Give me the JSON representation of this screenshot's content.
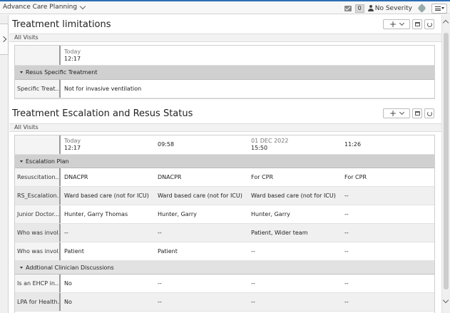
{
  "topbar": {
    "app_title": "Advance Care Planning",
    "count": "0",
    "severity": "No Severity"
  },
  "treatment_limitations": {
    "title": "Treatment limitations",
    "visits_label": "All Visits",
    "columns": [
      {
        "day": "Today",
        "time": "12:17"
      }
    ],
    "group": "Resus Specific Treatment",
    "rows": [
      {
        "label": "Specific Treat...",
        "values": [
          "Not for invasive ventilation"
        ]
      }
    ]
  },
  "escalation": {
    "title": "Treatment Escalation and Resus Status",
    "visits_label": "All Visits",
    "columns": [
      {
        "day": "Today",
        "time": "12:17"
      },
      {
        "day": "",
        "time": "09:58"
      },
      {
        "day": "01 DEC 2022",
        "time": "15:50"
      },
      {
        "day": "",
        "time": "11:26"
      }
    ],
    "group1": "Escalation Plan",
    "rows1": [
      {
        "label": "Resuscitation...",
        "values": [
          "DNACPR",
          "DNACPR",
          "For CPR",
          "For CPR"
        ]
      },
      {
        "label": "RS_Escalation...",
        "values": [
          "Ward based care (not for ICU)",
          "Ward based care (not for ICU)",
          "Ward based care (not for ICU)",
          "--"
        ]
      },
      {
        "label": "Junior Doctor...",
        "values": [
          "Hunter, Garry Thomas",
          "Hunter, Garry",
          "Hunter, Garry",
          "--"
        ]
      },
      {
        "label": "Who was invol...",
        "values": [
          "--",
          "--",
          "Patient, Wider team",
          "--"
        ]
      },
      {
        "label": "Who was invol...",
        "values": [
          "Patient",
          "Patient",
          "--",
          "--"
        ]
      }
    ],
    "group2": "Addtional Clinician Discussions",
    "rows2": [
      {
        "label": "Is an EHCP in...",
        "values": [
          "No",
          "--",
          "--",
          "--"
        ]
      },
      {
        "label": "LPA for Health...",
        "values": [
          "No",
          "--",
          "--",
          "--"
        ]
      }
    ]
  }
}
